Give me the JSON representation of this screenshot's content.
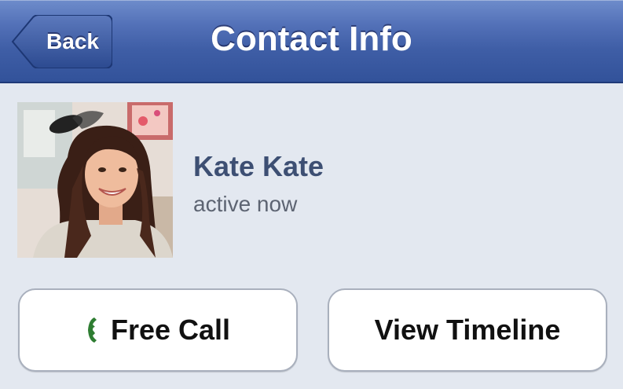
{
  "navbar": {
    "title": "Contact Info",
    "back_label": "Back"
  },
  "contact": {
    "name": "Kate Kate",
    "status": "active now",
    "avatar": "profile-photo"
  },
  "actions": {
    "free_call_label": "Free Call",
    "free_call_icon": "phone-icon",
    "view_timeline_label": "View Timeline"
  },
  "colors": {
    "navbar": "#4767ad",
    "background": "#e3e8f0",
    "name_text": "#3d4f73",
    "phone_icon": "#2e7d32"
  }
}
